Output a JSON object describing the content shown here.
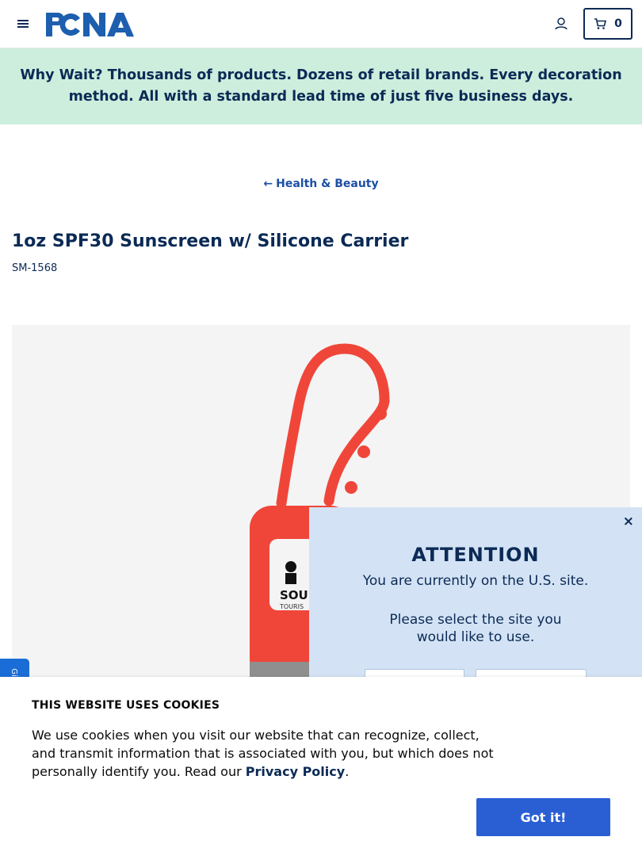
{
  "header": {
    "cart_count": "0"
  },
  "promo": {
    "lead": "Why Wait?",
    "text": " Thousands of products. Dozens of retail brands. Every decoration method. All with a standard lead time of just five business days."
  },
  "breadcrumb": {
    "label": "Health & Beauty"
  },
  "product": {
    "title": "1oz SPF30 Sunscreen w/ Silicone Carrier",
    "sku": "SM-1568",
    "imprint_text": "SOU",
    "imprint_subtext": "TOURIS"
  },
  "feedback_tab": {
    "label": "Gi"
  },
  "site_modal": {
    "close": "×",
    "title": "ATTENTION",
    "line1": "You are currently on the U.S. site.",
    "line2": "Please select the site you",
    "line3": "would like to use."
  },
  "cookie_banner": {
    "title": "THIS WEBSITE USES COOKIES",
    "text": "We use cookies when you visit our website that can recognize, collect, and transmit information that is associated with you, but which does not personally identify you. Read our ",
    "link": "Privacy Policy",
    "suffix": ".",
    "button": "Got it!"
  },
  "colors": {
    "brand_navy": "#0b2a55",
    "promo_bg": "#cdeedd",
    "accent_blue": "#2a5fd4",
    "modal_bg": "#d3e3f5",
    "product_red": "#f0463a"
  }
}
